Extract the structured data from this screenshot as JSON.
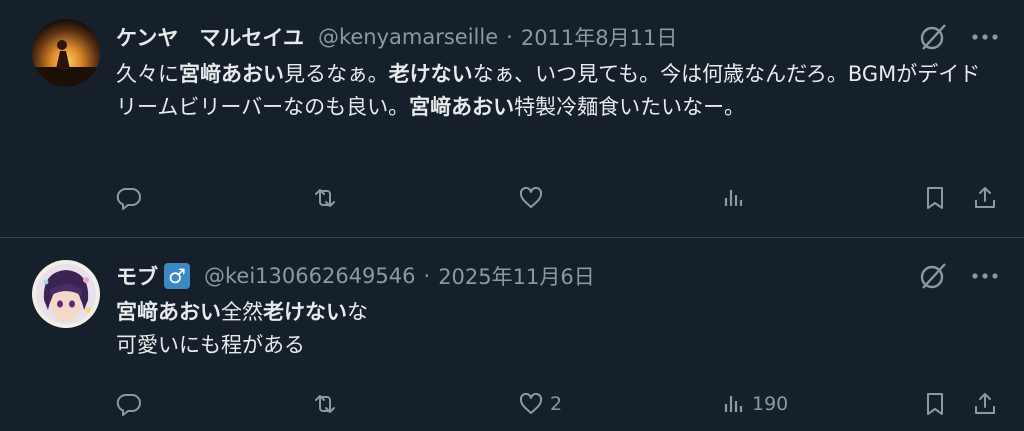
{
  "tweets": [
    {
      "name": "ケンヤ　マルセイユ",
      "handle": "@kenyamarseille",
      "separator": "·",
      "date": "2011年8月11日",
      "text_parts": [
        {
          "t": "久々に",
          "b": false
        },
        {
          "t": "宮﨑あおい",
          "b": true
        },
        {
          "t": "見るなぁ。",
          "b": false
        },
        {
          "t": "老けない",
          "b": true
        },
        {
          "t": "なぁ、いつ見ても。今は何歳なんだろ。BGMがデイドリームビリーバーなのも良い。",
          "b": false
        },
        {
          "t": "宮﨑あおい",
          "b": true
        },
        {
          "t": "特製冷麺食いたいなー。",
          "b": false
        }
      ],
      "actions": {
        "reply": "",
        "retweet": "",
        "like": "",
        "views": ""
      }
    },
    {
      "name": "モブ",
      "badge": "♂",
      "handle": "@kei130662649546",
      "separator": "·",
      "date": "2025年11月6日",
      "text_parts": [
        {
          "t": "宮﨑あおい",
          "b": true
        },
        {
          "t": "全然",
          "b": false
        },
        {
          "t": "老けない",
          "b": true
        },
        {
          "t": "な",
          "b": false
        },
        {
          "t": "\n",
          "b": false
        },
        {
          "t": "可愛いにも程がある",
          "b": false
        }
      ],
      "actions": {
        "reply": "",
        "retweet": "",
        "like": "2",
        "views": "190"
      }
    }
  ],
  "colors": {
    "background": "#15202b",
    "text": "#e7e9ea",
    "muted": "#8b98a5",
    "divider": "#38444d",
    "badge": "#3b88c3"
  }
}
